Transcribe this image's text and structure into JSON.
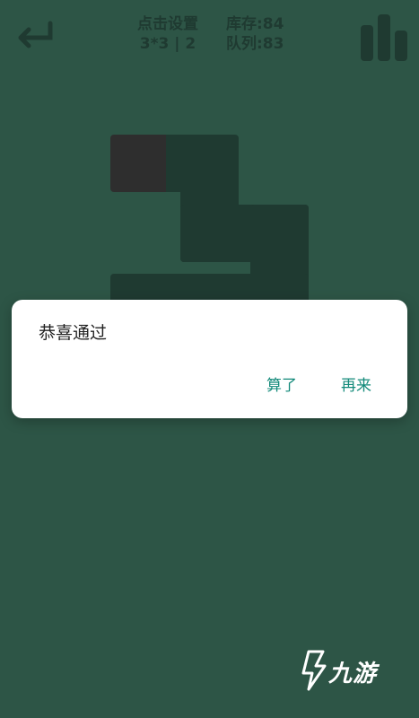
{
  "header": {
    "settings_label": "点击设置",
    "grid_info": "3*3 | 2",
    "stock_label": "库存:84",
    "queue_label": "队列:83"
  },
  "board": {
    "grid_size": "3*3",
    "empty_cell": {
      "row": 0,
      "col": 0
    }
  },
  "dialog": {
    "message": "恭喜通过",
    "cancel_label": "算了",
    "retry_label": "再来"
  },
  "watermark": {
    "text": "九游"
  },
  "colors": {
    "background": "#2d5546",
    "tile": "#1f3a31",
    "empty_tile": "#2e2e2e",
    "dialog_button": "#138a7a"
  }
}
